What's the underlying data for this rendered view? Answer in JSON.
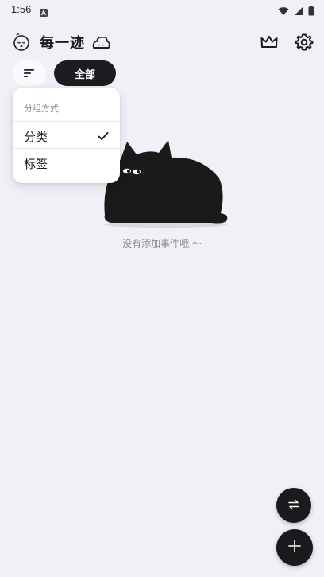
{
  "status_bar": {
    "time": "1:56"
  },
  "header": {
    "title": "每一迹"
  },
  "filters": {
    "all_label": "全部"
  },
  "group_menu": {
    "title": "分组方式",
    "items": [
      {
        "label": "分类",
        "selected": true
      },
      {
        "label": "标签",
        "selected": false
      }
    ]
  },
  "empty_state": {
    "message": "没有添加事件哦 ～"
  },
  "colors": {
    "background": "#f2f0f7",
    "primary_dark": "#1d1c20",
    "surface": "#ffffff"
  }
}
